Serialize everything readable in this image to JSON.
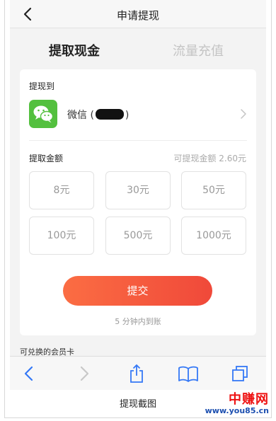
{
  "nav": {
    "title": "申请提现"
  },
  "tabs": [
    {
      "label": "提取现金",
      "active": true
    },
    {
      "label": "流量充值",
      "active": false
    }
  ],
  "withdraw_to": {
    "label": "提现到",
    "account_name": "微信 (",
    "account_suffix": ")",
    "icon": "wechat-icon"
  },
  "amount": {
    "label": "提取金额",
    "available": "可提现金额 2.60元",
    "options": [
      "8元",
      "30元",
      "50元",
      "100元",
      "500元",
      "1000元"
    ]
  },
  "submit_label": "提交",
  "arrival_note": "5 分钟内到账",
  "member_cards_label": "可兑换的会员卡",
  "caption": "提现截图",
  "watermark": {
    "title": "中赚网",
    "url": "www.you85.cn"
  },
  "colors": {
    "accent": "#f0493a",
    "wechat": "#53c03e",
    "ios_blue": "#3478f6",
    "watermark_red": "#e11111",
    "watermark_blue": "#1c4fb0"
  }
}
